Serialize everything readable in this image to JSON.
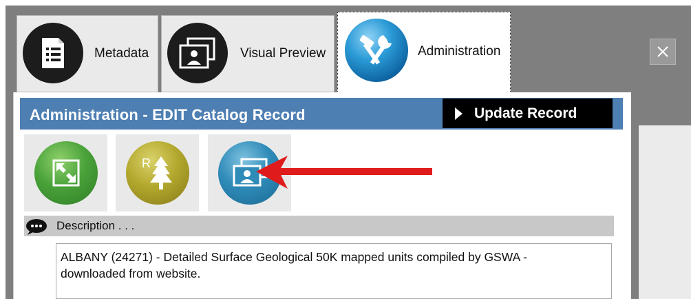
{
  "tabs": [
    {
      "label": "Metadata",
      "icon": "document-list-icon"
    },
    {
      "label": "Visual Preview",
      "icon": "photo-frames-icon"
    },
    {
      "label": "Administration",
      "icon": "tools-icon",
      "selected": true
    }
  ],
  "close_icon": "close-icon",
  "admin": {
    "title": "Administration - EDIT Catalog Record",
    "update_label": "Update Record",
    "tools": [
      {
        "icon": "extent-arrows-icon"
      },
      {
        "icon": "resource-tree-icon"
      },
      {
        "icon": "preview-image-icon"
      }
    ],
    "description_label": "Description . . .",
    "description_value": "ALBANY (24271) - Detailed Surface Geological 50K mapped units compiled by GSWA -\ndownloaded from website."
  },
  "colors": {
    "title_bar": "#4e7fb3",
    "update_button": "#000000",
    "arrow": "#e01b1b",
    "frame": "#7f7f7f"
  }
}
